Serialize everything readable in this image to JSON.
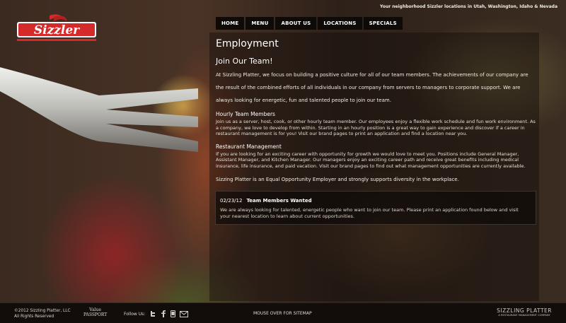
{
  "tagline": "Your neighborhood Sizzler locations in Utah, Washington, Idaho & Nevada",
  "logo": {
    "text": "Sizzler"
  },
  "nav": [
    "HOME",
    "MENU",
    "ABOUT US",
    "LOCATIONS",
    "SPECIALS"
  ],
  "page": {
    "title": "Employment",
    "subtitle": "Join Our Team!",
    "intro": "At Sizzling Platter, we focus on building a positive culture for all of our team members. The achievements of our company are the result of the combined efforts of all individuals in our company from servers to managers to corporate support. We are always looking for energetic, fun and talented people to join our team.",
    "sections": [
      {
        "heading": "Hourly Team Members",
        "text": "Join us as a server, host, cook, or other hourly team member. Our employees enjoy a flexible work schedule and fun work environment. As a company, we love to develop from within. Starting in an hourly position is a great way to gain experience and discover if a career in restaurant management is for you! Visit our brand pages to print an application and find a location near you."
      },
      {
        "heading": "Restaurant Management",
        "text": "If you are looking for an exciting career with opportunity for growth we would love to meet you. Positions include General Manager, Assistant Manager, and Kitchen Manager. Our managers enjoy an exciting career path and receive great benefits including medical insurance, life insurance, and paid vacation. Visit our brand pages to find out what management opportunities are currently available."
      }
    ],
    "eeo": "Sizzing Platter is an Equal Opportunity Employer and strongly supports diversity in the workplace."
  },
  "news": {
    "date": "02/23/12",
    "title": "Team Members Wanted",
    "body": "We are always looking for talented, energetic people who want to join our team. Please print an application found below and visit your nearest location to learn about current opportunities."
  },
  "footer": {
    "copyright": "©2012 Sizzling Platter, LLC",
    "rights": "All Rights Reserved",
    "value_passport_line1": "Value",
    "value_passport_line2": "PASSPORT",
    "follow_label": "Follow Us:",
    "sitemap": "MOUSE OVER FOR SITEMAP",
    "brand": "SIZZLING PLATTER",
    "brand_sub": "A RESTAURANT MANAGEMENT COMPANY"
  },
  "colors": {
    "logo_red": "#d42a2a",
    "nav_bg": "#0e0a08",
    "footer_bg": "#120d0a"
  }
}
